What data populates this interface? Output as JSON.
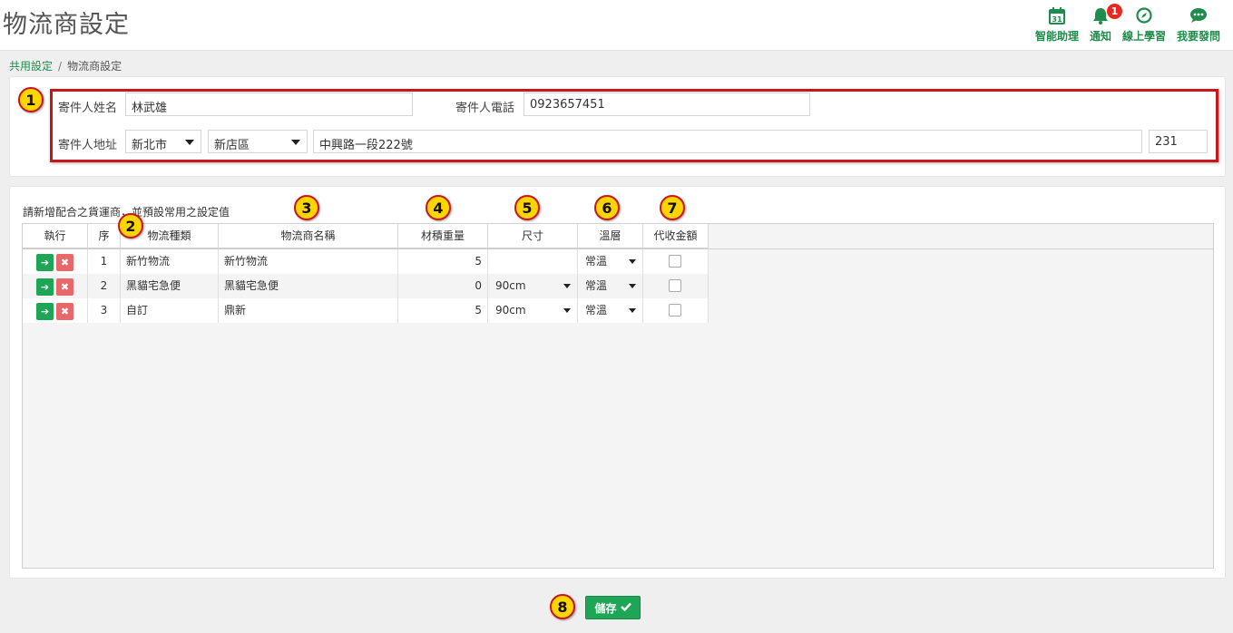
{
  "page": {
    "title": "物流商設定"
  },
  "top_actions": [
    {
      "label": "智能助理",
      "icon": "calendar-icon"
    },
    {
      "label": "通知",
      "icon": "bell-icon",
      "badge": "1"
    },
    {
      "label": "線上學習",
      "icon": "compass-icon"
    },
    {
      "label": "我要發問",
      "icon": "chat-icon"
    }
  ],
  "breadcrumb": {
    "parent": "共用設定",
    "separator": "/",
    "current": "物流商設定"
  },
  "markers": [
    "1",
    "2",
    "3",
    "4",
    "5",
    "6",
    "7",
    "8"
  ],
  "sender": {
    "name_label": "寄件人姓名",
    "name_value": "林武雄",
    "phone_label": "寄件人電話",
    "phone_value": "0923657451",
    "address_label": "寄件人地址",
    "city": "新北市",
    "district": "新店區",
    "street": "中興路一段222號",
    "zip": "231"
  },
  "carriers": {
    "note": "請新增配合之貨運商，並預設常用之設定值",
    "headers": [
      "執行",
      "序",
      "物流種類",
      "物流商名稱",
      "材積重量",
      "尺寸",
      "溫層",
      "代收金額"
    ],
    "rows": [
      {
        "seq": "1",
        "type": "新竹物流",
        "name": "新竹物流",
        "weight": "5",
        "size": "",
        "temp": "常溫",
        "cod": false
      },
      {
        "seq": "2",
        "type": "黑貓宅急便",
        "name": "黑貓宅急便",
        "weight": "0",
        "size": "90cm",
        "temp": "常溫",
        "cod": false
      },
      {
        "seq": "3",
        "type": "自訂",
        "name": "鼎新",
        "weight": "5",
        "size": "90cm",
        "temp": "常溫",
        "cod": false
      }
    ]
  },
  "actions": {
    "save_label": "儲存"
  },
  "colors": {
    "brand_green": "#1ea556",
    "link_green": "#1e8c4b",
    "annotation_red": "#c8161d",
    "marker_yellow": "#ffd500",
    "delete_red": "#e8676a"
  }
}
